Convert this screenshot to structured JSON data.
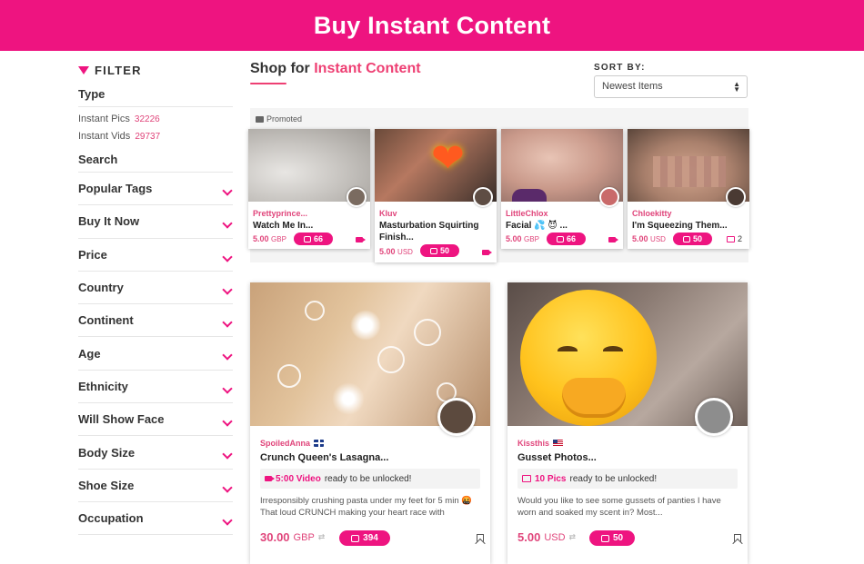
{
  "header": {
    "title": "Buy Instant Content"
  },
  "sidebar": {
    "filter_label": "FILTER",
    "type_title": "Type",
    "types": [
      {
        "label": "Instant Pics",
        "count": "32226"
      },
      {
        "label": "Instant Vids",
        "count": "29737"
      }
    ],
    "search_label": "Search",
    "sections": [
      "Popular Tags",
      "Buy It Now",
      "Price",
      "Country",
      "Continent",
      "Age",
      "Ethnicity",
      "Will Show Face",
      "Body Size",
      "Shoe Size",
      "Occupation"
    ]
  },
  "main": {
    "shop_prefix": "Shop for",
    "shop_accent": "Instant Content",
    "sort_label": "SORT BY:",
    "sort_value": "Newest Items",
    "promoted_label": "Promoted",
    "promoted": [
      {
        "seller": "Prettyprince...",
        "title": "Watch Me In...",
        "title2": "",
        "price": "5.00",
        "currency": "GBP",
        "count": "66",
        "media": "video",
        "pics": ""
      },
      {
        "seller": "Kluv",
        "title": "Masturbation Squirting",
        "title2": "Finish...",
        "price": "5.00",
        "currency": "USD",
        "count": "50",
        "media": "video",
        "pics": ""
      },
      {
        "seller": "LittleChlox",
        "title": "Facial 💦 😈 ...",
        "title2": "",
        "price": "5.00",
        "currency": "GBP",
        "count": "66",
        "media": "video",
        "pics": ""
      },
      {
        "seller": "Chloekitty",
        "title": "I'm Squeezing Them...",
        "title2": "",
        "price": "5.00",
        "currency": "USD",
        "count": "50",
        "media": "pics",
        "pics": "2"
      }
    ],
    "items": [
      {
        "seller": "SpoiledAnna",
        "flag": "uk",
        "title": "Crunch Queen's Lasagna...",
        "ready_hl": "5:00 Video",
        "ready_rest": "ready to be unlocked!",
        "desc": "Irresponsibly crushing pasta under my feet for 5 min 🤬 That loud CRUNCH making your heart race with",
        "price": "30.00",
        "currency": "GBP",
        "count": "394"
      },
      {
        "seller": "Kissthis",
        "flag": "us",
        "title": "Gusset Photos...",
        "ready_hl": "10 Pics",
        "ready_rest": "ready to be unlocked!",
        "desc": "Would you like to see some gussets of panties I have worn and soaked my scent in? Most...",
        "price": "5.00",
        "currency": "USD",
        "count": "50"
      }
    ],
    "colors": {
      "brand": "#ee1480",
      "accent": "#e0457b"
    }
  }
}
